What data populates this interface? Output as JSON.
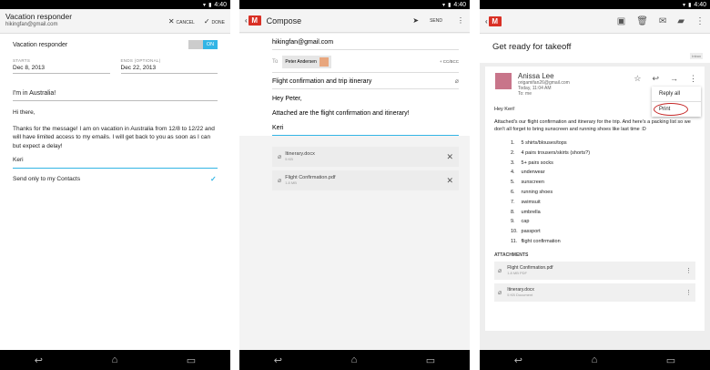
{
  "status": {
    "time": "4:40"
  },
  "panel1": {
    "title": "Vacation responder",
    "account": "hikingfan@gmail.com",
    "cancel_label": "CANCEL",
    "done_label": "DONE",
    "responder_label": "Vacation responder",
    "toggle_on": "ON",
    "starts_label": "STARTS",
    "starts_value": "Dec 8, 2013",
    "ends_label": "ENDS (OPTIONAL)",
    "ends_value": "Dec 22, 2013",
    "subject": "I'm in Australia!",
    "greeting": "Hi there,",
    "body": "Thanks for the message! I am on vacation in Australia from 12/8 to 12/22 and will have limited access to my emails. I will get back to you as soon as I can but expect a delay!",
    "signature": "Keri",
    "contacts_only": "Send only to my Contacts"
  },
  "panel2": {
    "title": "Compose",
    "send_label": "SEND",
    "from": "hikingfan@gmail.com",
    "to_label": "To",
    "to_chip": "Peter Andersen",
    "cc_bcc": "+ CC/BCC",
    "subject": "Flight confirmation and trip itinerary",
    "greeting": "Hey Peter,",
    "body": "Attached are the flight confirmation and itinerary!",
    "signature": "Keri",
    "attachments": [
      {
        "name": "Itinerary.docx",
        "size": "5 KB"
      },
      {
        "name": "Flight Confirmation.pdf",
        "size": "1.8 MB"
      }
    ]
  },
  "panel3": {
    "subject": "Get ready for takeoff",
    "inbox_badge": "Inbox",
    "sender_name": "Anissa Lee",
    "sender_email": "origamifan26@gmail.com",
    "date": "Today, 11:04 AM",
    "to": "To: me",
    "menu": {
      "reply_all": "Reply all",
      "print": "Print"
    },
    "greeting": "Hey Keri!",
    "intro": "Attached's our flight confirmation and itinerary for the trip. And here's a packing list so we don't all forget to bring sunscreen and running shoes like last time :D",
    "list": [
      {
        "n": "1.",
        "text": "5 shirts/blouses/tops"
      },
      {
        "n": "2.",
        "text": "4 pairs trousers/skirts (shorts?)"
      },
      {
        "n": "3.",
        "text": "5+ pairs socks"
      },
      {
        "n": "4.",
        "text": "underwear"
      },
      {
        "n": "5.",
        "text": "sunscreen"
      },
      {
        "n": "6.",
        "text": "running shoes"
      },
      {
        "n": "7.",
        "text": "swimsuit"
      },
      {
        "n": "8.",
        "text": "umbrella"
      },
      {
        "n": "9.",
        "text": "cap"
      },
      {
        "n": "10.",
        "text": "passport"
      },
      {
        "n": "11.",
        "text": "flight confirmation"
      }
    ],
    "attachments_label": "ATTACHMENTS",
    "attachments": [
      {
        "name": "Flight Confirmation.pdf",
        "size": "1.8 MB PDF"
      },
      {
        "name": "Itinerary.docx",
        "size": "5 KB Document"
      }
    ]
  }
}
